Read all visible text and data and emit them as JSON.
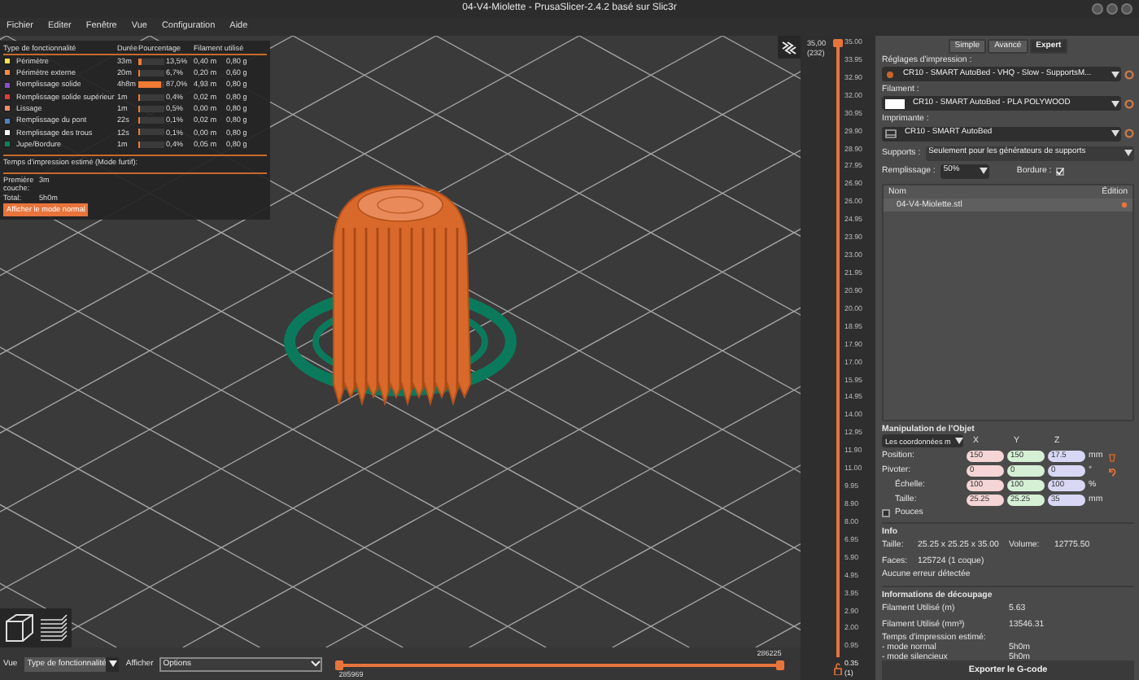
{
  "window": {
    "title": "04-V4-Miolette - PrusaSlicer-2.4.2 basé sur Slic3r"
  },
  "menu": [
    "Fichier",
    "Editer",
    "Fenêtre",
    "Vue",
    "Configuration",
    "Aide"
  ],
  "legend": {
    "columns": [
      "Type de fonctionnalité",
      "Durée",
      "Pourcentage",
      "Filament utilisé"
    ],
    "rows": [
      {
        "name": "Périmètre",
        "color": "#ffe14d",
        "duration": "33m",
        "percentage": "13,5%",
        "level": 0.135,
        "length": "0,40 m",
        "weight": "0,80 g"
      },
      {
        "name": "Périmètre externe",
        "color": "#ff8a3d",
        "duration": "20m",
        "percentage": "6,7%",
        "level": 0.067,
        "length": "0,20 m",
        "weight": "0,60 g"
      },
      {
        "name": "Remplissage solide",
        "color": "#8a4fd0",
        "duration": "4h8m",
        "percentage": "87,0%",
        "level": 0.87,
        "length": "4,93 m",
        "weight": "0,80 g"
      },
      {
        "name": "Remplissage solide supérieur",
        "color": "#e03c3c",
        "duration": "1m",
        "percentage": "0,4%",
        "level": 0.004,
        "length": "0,02 m",
        "weight": "0,80 g"
      },
      {
        "name": "Lissage",
        "color": "#ff8a6a",
        "duration": "1m",
        "percentage": "0,5%",
        "level": 0.005,
        "length": "0,00 m",
        "weight": "0,80 g"
      },
      {
        "name": "Remplissage du pont",
        "color": "#5080c0",
        "duration": "22s",
        "percentage": "0,1%",
        "level": 0.001,
        "length": "0,02 m",
        "weight": "0,80 g"
      },
      {
        "name": "Remplissage des trous",
        "color": "#ffffff",
        "duration": "12s",
        "percentage": "0,1%",
        "level": 0.001,
        "length": "0,00 m",
        "weight": "0,80 g"
      },
      {
        "name": "Jupe/Bordure",
        "color": "#108060",
        "duration": "1m",
        "percentage": "0,4%",
        "level": 0.004,
        "length": "0,05 m",
        "weight": "0,80 g"
      }
    ],
    "estimate_title": "Temps d'impression estimé (Mode furtif):",
    "first_layer": {
      "label": "Première couche:",
      "value": "3m"
    },
    "total": {
      "label": "Total:",
      "value": "5h0m"
    },
    "button": "Afficher le mode normal"
  },
  "vertical_slider": {
    "top_value": "35,00",
    "top_layer": "(232)",
    "ticks": [
      "35.00",
      "33.95",
      "32.90",
      "32.00",
      "30.95",
      "29.90",
      "28.90",
      "27.95",
      "26.90",
      "26.00",
      "24.95",
      "23.90",
      "23.00",
      "21.95",
      "20.90",
      "20.00",
      "18.95",
      "17.90",
      "17.00",
      "15.95",
      "14.95",
      "14.00",
      "12.95",
      "11.90",
      "11.00",
      "9.95",
      "8.90",
      "8.00",
      "6.95",
      "5.90",
      "4.95",
      "3.95",
      "2.90",
      "2.00",
      "0.95"
    ],
    "bottom_value": "0.35",
    "bottom_layer": "(1)"
  },
  "bottom_bar": {
    "view_label": "Vue",
    "view_value": "Type de fonctionnalité",
    "show_label": "Afficher",
    "show_value": "Options",
    "slider_start": "285969",
    "slider_end": "286225"
  },
  "sidebar": {
    "modes": [
      {
        "label": "Simple",
        "selected": false
      },
      {
        "label": "Avancé",
        "selected": false
      },
      {
        "label": "Expert",
        "selected": true
      }
    ],
    "presets": [
      {
        "kind": "print",
        "label": "Réglages d'impression :",
        "value": "CR10 - SMART AutoBed - VHQ - Slow - SupportsM..."
      },
      {
        "kind": "filament",
        "label": "Filament :",
        "value": "CR10 - SMART AutoBed - PLA POLYWOOD"
      },
      {
        "kind": "printer",
        "label": "Imprimante :",
        "value": "CR10 - SMART AutoBed"
      }
    ],
    "supports": {
      "label": "Supports :",
      "value": "Seulement pour les générateurs de supports"
    },
    "infill": {
      "label": "Remplissage :",
      "value": "50%"
    },
    "brim": {
      "label": "Bordure :",
      "checked": true
    },
    "object_list": {
      "columns": [
        "Nom",
        "Édition"
      ],
      "rows": [
        {
          "name": "04-V4-Miolette.stl",
          "selected": true
        }
      ]
    },
    "manipulation": {
      "title": "Manipulation de l'Objet",
      "coordinates": "Les coordonnées m",
      "axes": [
        "X",
        "Y",
        "Z"
      ],
      "rows": [
        {
          "label": "Position:",
          "values": [
            "150",
            "150",
            "17.5"
          ],
          "unit": "mm"
        },
        {
          "label": "Pivoter:",
          "values": [
            "0",
            "0",
            "0"
          ],
          "unit": "°"
        },
        {
          "label": "Échelle:",
          "values": [
            "100",
            "100",
            "100"
          ],
          "unit": "%"
        },
        {
          "label": "Taille:",
          "values": [
            "25.25",
            "25.25",
            "35"
          ],
          "unit": "mm"
        }
      ],
      "inches": {
        "label": "Pouces",
        "checked": false
      }
    },
    "info": {
      "title": "Info",
      "size_label": "Taille:",
      "size": "25.25 x 25.25 x 35.00",
      "volume_label": "Volume:",
      "volume": "12775.50",
      "faces_label": "Faces:",
      "faces": "125724 (1 coque)",
      "status": "Aucune erreur détectée"
    },
    "slicing": {
      "title": "Informations de découpage",
      "rows": [
        {
          "label": "Filament Utilisé (m)",
          "value": "5.63"
        },
        {
          "label": "Filament Utilisé (mm³)",
          "value": "13546.31"
        }
      ],
      "time_title": "Temps d'impression estimé:",
      "times": [
        {
          "label": "- mode normal",
          "value": "5h0m"
        },
        {
          "label": "- mode silencieux",
          "value": "5h0m"
        }
      ]
    },
    "export_button": "Exporter le G-code"
  }
}
